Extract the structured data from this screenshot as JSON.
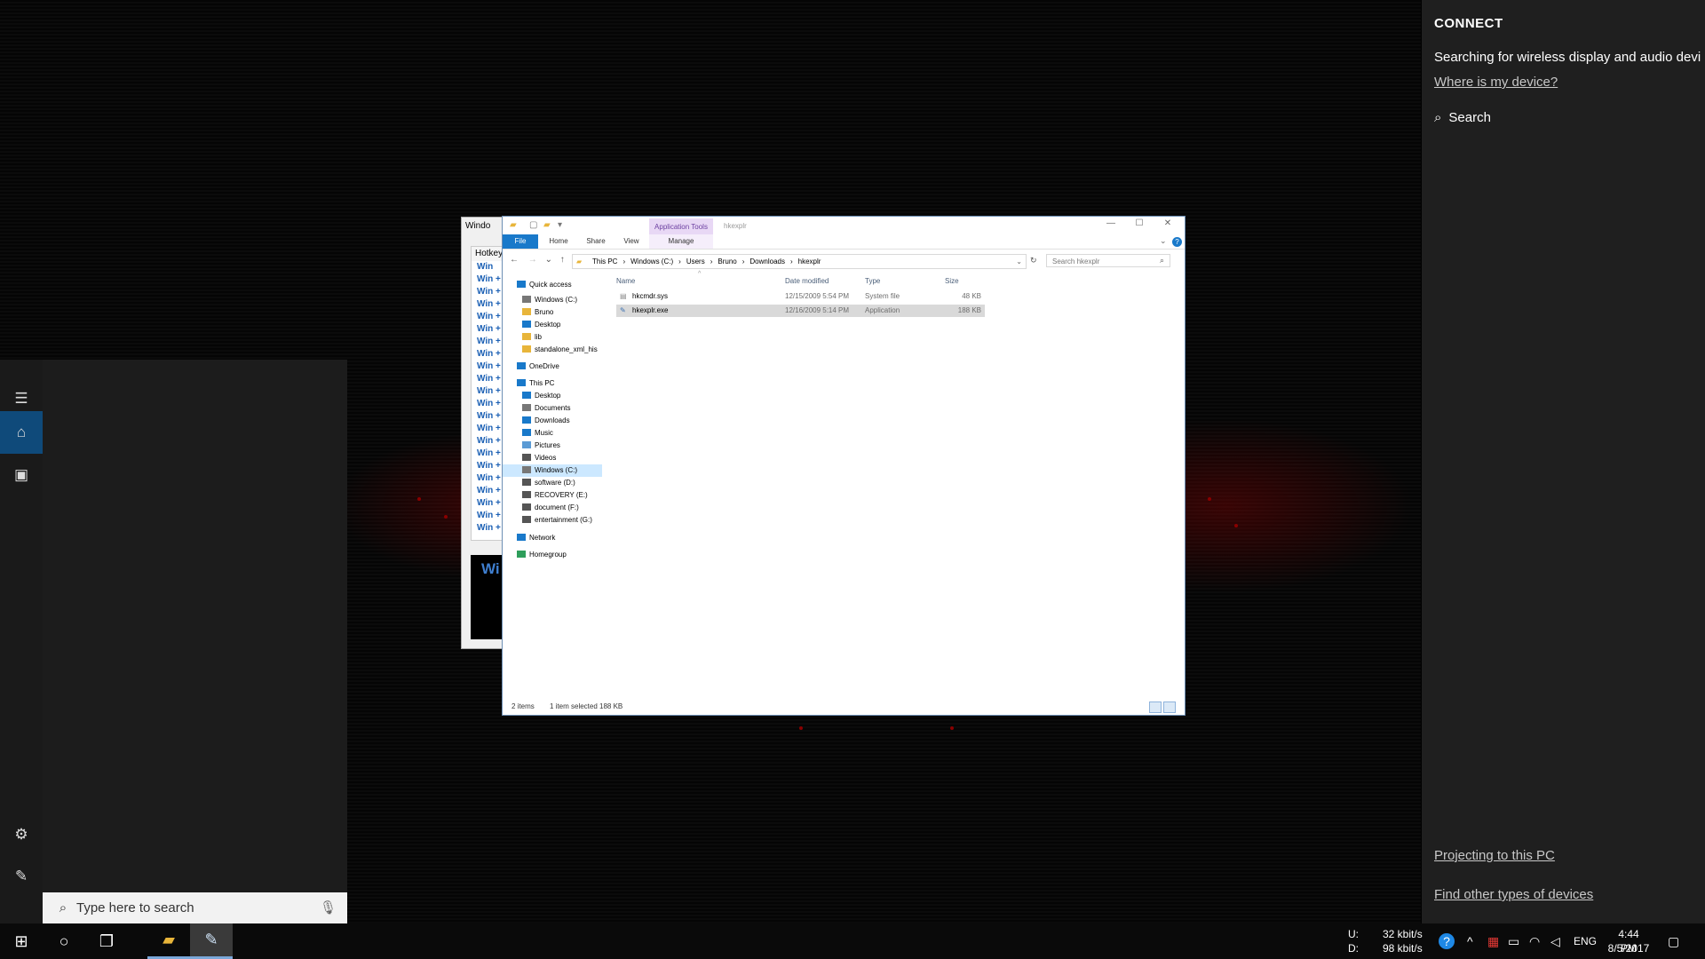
{
  "connect": {
    "title": "CONNECT",
    "message": "Searching for wireless display and audio devi",
    "where_link": "Where is my device?",
    "search_label": "Search",
    "projecting_link": "Projecting to this PC",
    "find_link": "Find other types of devices"
  },
  "start": {
    "search_placeholder": "Type here to search"
  },
  "taskbar": {
    "net_up": "32 kbit/s",
    "net_down": "98 kbit/s",
    "net_up_label": "U:",
    "net_down_label": "D:",
    "lang": "ENG",
    "time": "4:44 PM",
    "date": "8/5/2017"
  },
  "hotkey": {
    "title": "Windo",
    "header": "Hotkey",
    "items": [
      "Win",
      "Win +",
      "Win +",
      "Win +",
      "Win +",
      "Win +",
      "Win +",
      "Win +",
      "Win +",
      "Win +",
      "Win +",
      "Win +",
      "Win +",
      "Win +",
      "Win +",
      "Win +",
      "Win +",
      "Win +",
      "Win +",
      "Win +",
      "Win +",
      "Win +"
    ],
    "banner": "Wi"
  },
  "explorer": {
    "app_tools": "Application Tools",
    "title": "hkexplr",
    "tabs": [
      "File",
      "Home",
      "Share",
      "View"
    ],
    "manage_tab": "Manage",
    "breadcrumb": [
      "This PC",
      "Windows (C:)",
      "Users",
      "Bruno",
      "Downloads",
      "hkexplr"
    ],
    "search_placeholder": "Search hkexplr",
    "nav": [
      "Quick access",
      "Windows (C:)",
      "Bruno",
      "Desktop",
      "lib",
      "standalone_xml_his",
      "OneDrive",
      "This PC",
      "Desktop",
      "Documents",
      "Downloads",
      "Music",
      "Pictures",
      "Videos",
      "Windows (C:)",
      "software (D:)",
      "RECOVERY (E:)",
      "document (F:)",
      "entertainment (G:)",
      "Network",
      "Homegroup"
    ],
    "columns": [
      "Name",
      "Date modified",
      "Type",
      "Size"
    ],
    "files": [
      {
        "name": "hkcmdr.sys",
        "date": "12/15/2009 5:54 PM",
        "type": "System file",
        "size": "48 KB"
      },
      {
        "name": "hkexplr.exe",
        "date": "12/16/2009 5:14 PM",
        "type": "Application",
        "size": "188 KB"
      }
    ],
    "status_items": "2 items",
    "status_selected": "1 item selected  188 KB"
  }
}
